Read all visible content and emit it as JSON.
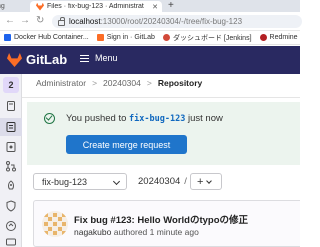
{
  "browser": {
    "first_tab_label": "ng",
    "active_tab_title": "Files · fix-bug-123 · Administrat",
    "new_tab_symbol": "+",
    "url_host": "localhost",
    "url_path": ":13000/root/20240304/-/tree/fix-bug-123",
    "bookmarks": [
      {
        "label": "Docker Hub Container..."
      },
      {
        "label": "Sign in · GitLab"
      },
      {
        "label": "ダッシュボード [Jenkins]"
      },
      {
        "label": "Redmine"
      }
    ]
  },
  "gitlab": {
    "brand": "GitLab",
    "menu_label": "Menu",
    "project_avatar_letter": "2"
  },
  "breadcrumb": {
    "items": [
      "Administrator",
      "20240304",
      "Repository"
    ],
    "separator": ">"
  },
  "alert": {
    "prefix": "You pushed to ",
    "branch": "fix-bug-123",
    "suffix": " just now",
    "button_label": "Create merge request"
  },
  "controls": {
    "branch_value": "fix-bug-123",
    "path_root": "20240304",
    "path_separator": "/",
    "add_symbol": "+"
  },
  "commit": {
    "title": "Fix bug #123: Hello Worldのtypoの修正",
    "author": "nagakubo",
    "action": "authored",
    "time": "1 minute ago"
  },
  "colors": {
    "topbar": "#292961",
    "accent": "#1f75cb",
    "success_bg": "#ecf4ee",
    "success_icon": "#217645",
    "logo": "#fc6d26"
  }
}
